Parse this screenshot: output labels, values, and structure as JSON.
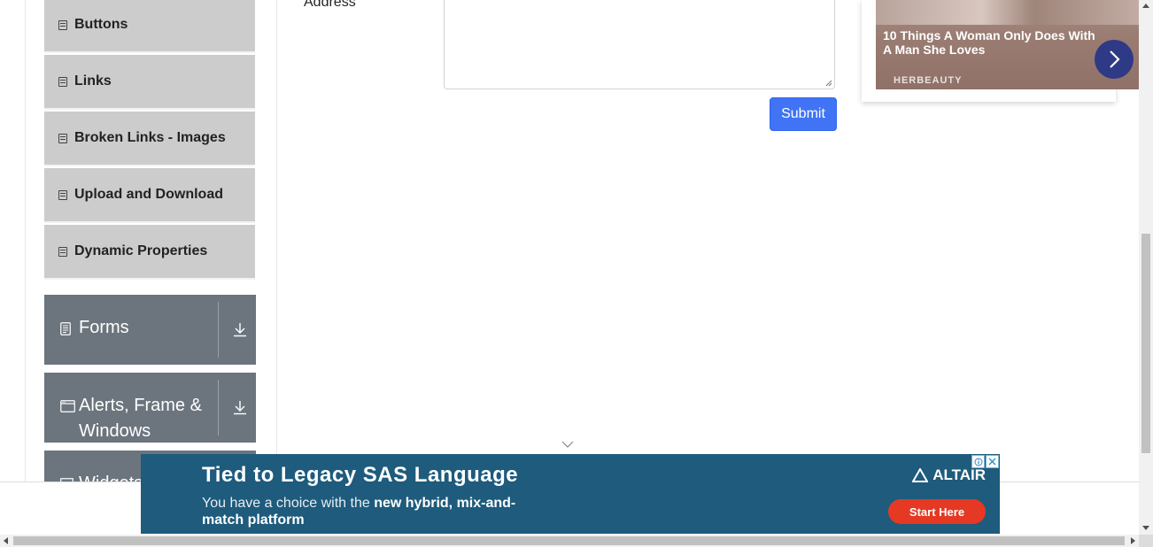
{
  "sidebar": {
    "items": [
      {
        "label": "Buttons"
      },
      {
        "label": "Links"
      },
      {
        "label": "Broken Links - Images"
      },
      {
        "label": "Upload and Download"
      },
      {
        "label": "Dynamic Properties"
      }
    ],
    "groups": [
      {
        "label": "Forms",
        "icon": "form-icon"
      },
      {
        "label": "Alerts, Frame &",
        "label2": "Windows",
        "icon": "window-icon"
      },
      {
        "label": "Widgets",
        "icon": "widgets-icon"
      }
    ]
  },
  "form": {
    "address_label": "Address",
    "submit_label": "Submit"
  },
  "ad_card": {
    "headline": "10 Things A Woman Only Does With A Man She Loves",
    "source": "HERBEAUTY"
  },
  "banner": {
    "title": "Tied to Legacy SAS Language",
    "sub_part1": "You have a choice with the ",
    "sub_bold": "new hybrid, mix-and-match platform",
    "brand": "ALTAIR",
    "cta": "Start Here"
  },
  "colors": {
    "sidebar_item_bg": "#cccccc",
    "group_bg": "#6c757d",
    "submit_bg": "#4074f5",
    "banner_bg": "#1e5b7c",
    "cta_bg": "#e53924"
  }
}
